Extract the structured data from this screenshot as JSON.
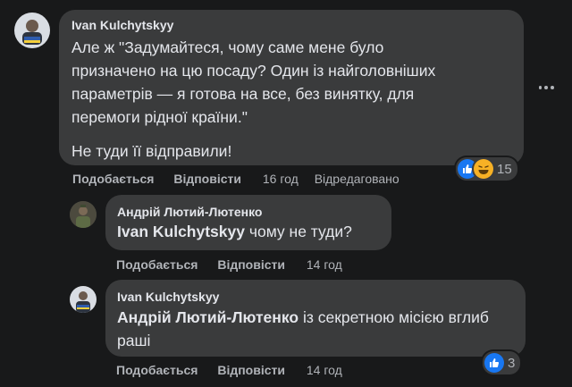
{
  "comments": [
    {
      "author": "Ivan Kulchytskyy",
      "paragraphs": [
        "Але ж \"Задумайтеся, чому саме мене було призначено на цю посаду? Один із найголовніших параметрів — я готова на все, без винятку, для перемоги рідної країни.\"",
        "Не туди її відправили!"
      ],
      "actions": {
        "like": "Подобається",
        "reply": "Відповісти",
        "time": "16 год",
        "edited": "Відредаговано"
      },
      "reactions": {
        "icons": [
          "like-icon",
          "haha-icon"
        ],
        "count": "15"
      }
    },
    {
      "author": "Андрій Лютий-Лютенко",
      "mention": "Ivan Kulchytskyy",
      "text": " чому не туди?",
      "actions": {
        "like": "Подобається",
        "reply": "Відповісти",
        "time": "14 год"
      }
    },
    {
      "author": "Ivan Kulchytskyy",
      "mention": "Андрій Лютий-Лютенко",
      "text": " із секретною місією вглиб раші",
      "actions": {
        "like": "Подобається",
        "reply": "Відповісти",
        "time": "14 год"
      },
      "reactions": {
        "icons": [
          "like-icon"
        ],
        "count": "3"
      }
    }
  ],
  "colors": {
    "background": "#18191a",
    "bubble": "#3a3b3c",
    "text": "#e4e6eb",
    "muted": "#b0b3b8",
    "like": "#1877f2",
    "haha": "#f7b125"
  }
}
